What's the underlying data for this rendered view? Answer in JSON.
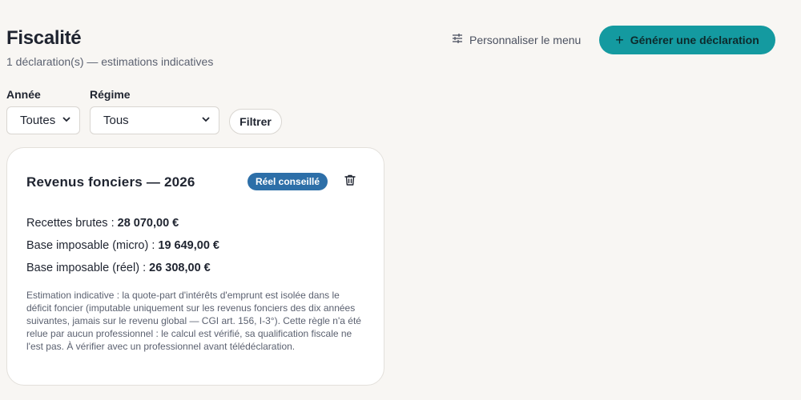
{
  "header": {
    "title": "Fiscalité",
    "subtitle": "1 déclaration(s) — estimations indicatives",
    "customize_menu_label": "Personnaliser le menu",
    "generate_button_label": "Générer une déclaration",
    "accent_color": "#149aa0"
  },
  "filters": {
    "year_label": "Année",
    "year_selected": "Toutes",
    "regime_label": "Régime",
    "regime_selected": "Tous",
    "filter_button_label": "Filtrer"
  },
  "declarations": [
    {
      "title": "Revenus fonciers — 2026",
      "badge": "Réel conseillé",
      "badge_color": "#2d6fa8",
      "gross_receipts_label": "Recettes brutes : ",
      "gross_receipts_value": "28 070,00 €",
      "base_micro_label": "Base imposable (micro) : ",
      "base_micro_value": "19 649,00 €",
      "base_real_label": "Base imposable (réel) : ",
      "base_real_value": "26 308,00 €",
      "note": "Estimation indicative : la quote-part d'intérêts d'emprunt est isolée dans le déficit foncier (imputable uniquement sur les revenus fonciers des dix années suivantes, jamais sur le revenu global — CGI art. 156, I-3°). Cette règle n'a été relue par aucun professionnel : le calcul est vérifié, sa qualification fiscale ne l'est pas. À vérifier avec un professionnel avant télédéclaration."
    }
  ]
}
